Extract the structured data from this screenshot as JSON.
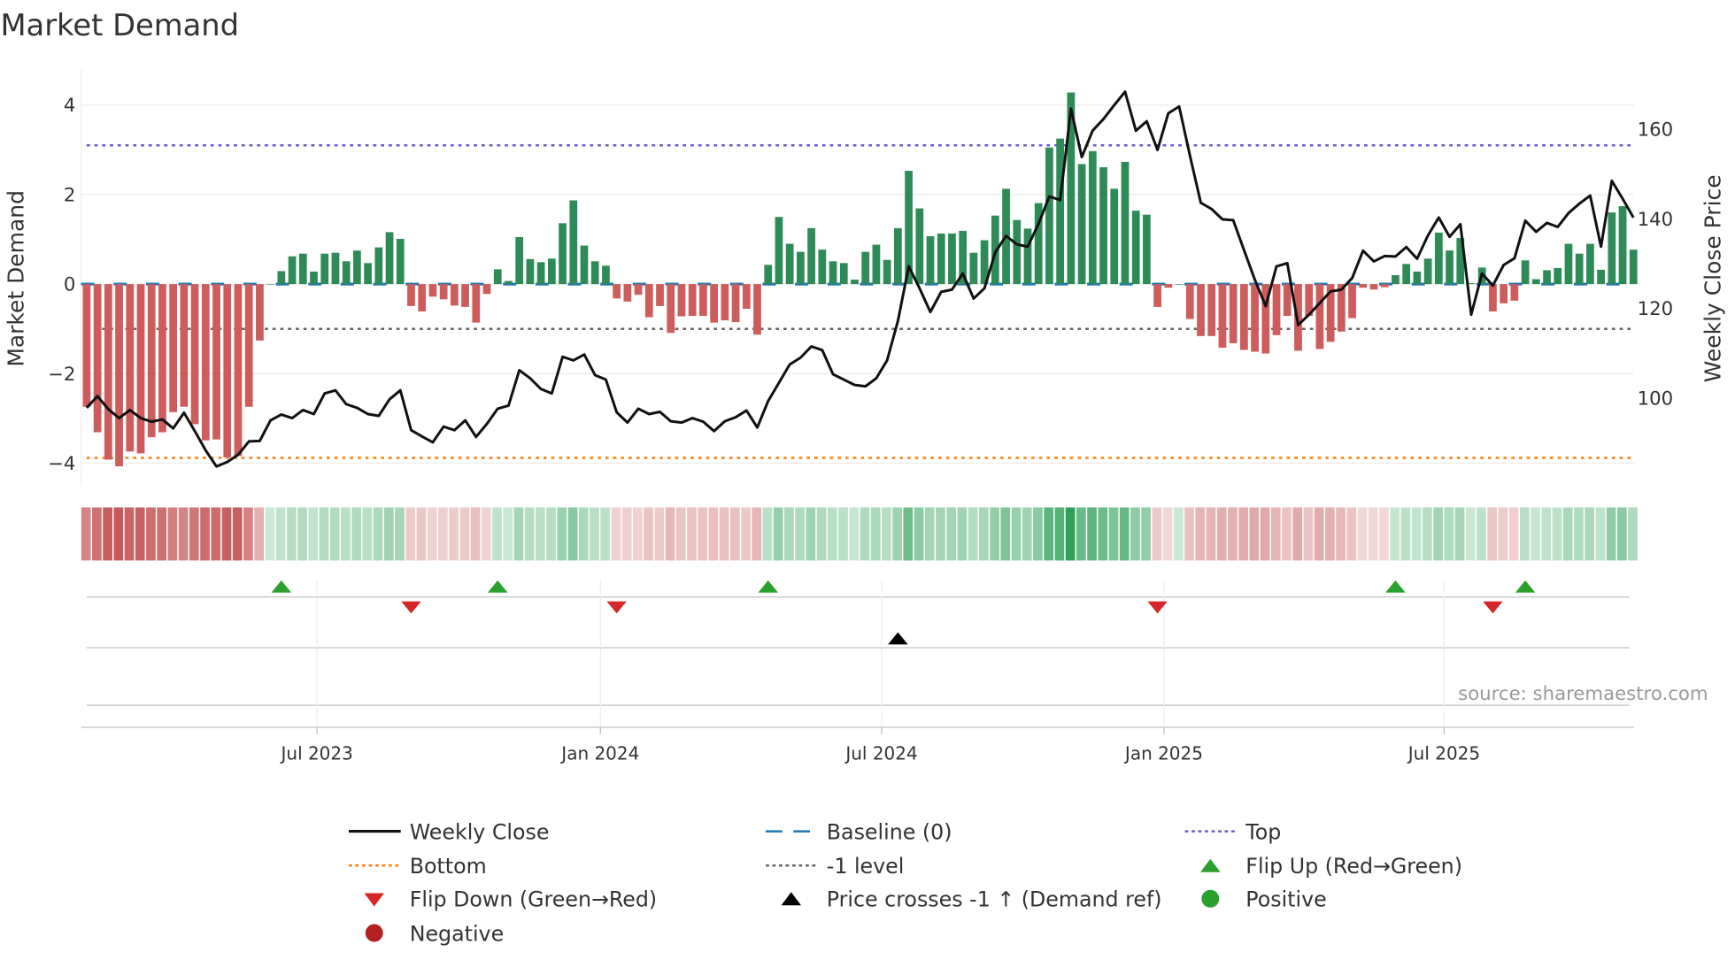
{
  "title": "Market Demand",
  "source": "source: sharemaestro.com",
  "colors": {
    "positive": "#2e8b57",
    "negative": "#cd5c5c",
    "baseline": "#1f77b4",
    "top": "#6a5acd",
    "bottom": "#ff7f0e",
    "minus_one": "#666666",
    "price": "#111111",
    "flip_up": "#2ca02c",
    "flip_down": "#d62728",
    "cross": "#000000"
  },
  "chart_data": {
    "type": "bar",
    "title": "Market Demand",
    "ylabel": "Market Demand",
    "y2label": "Weekly Close Price",
    "ylim": [
      -4.5,
      4.8
    ],
    "y2lim": [
      83,
      176
    ],
    "yticks": [
      4,
      2,
      0,
      -2,
      -4
    ],
    "ytick_labels": [
      "4",
      "2",
      "0",
      "−2",
      "−4"
    ],
    "y2ticks": [
      100,
      120,
      140,
      160
    ],
    "x_start": "2023-02-03",
    "x_step": "1 week",
    "xticks": [
      {
        "label": "Jul 2023",
        "week": 21.3
      },
      {
        "label": "Jan 2024",
        "week": 47.5
      },
      {
        "label": "Jul 2024",
        "week": 73.5
      },
      {
        "label": "Jan 2025",
        "week": 99.6
      },
      {
        "label": "Jul 2025",
        "week": 125.5
      }
    ],
    "levels": {
      "top": 3.1,
      "bottom": -3.88,
      "minus_one": -1,
      "baseline": 0
    },
    "demand": [
      -2.74,
      -3.31,
      -3.92,
      -4.07,
      -3.74,
      -3.78,
      -3.42,
      -3.31,
      -2.86,
      -2.74,
      -3.13,
      -3.49,
      -3.47,
      -3.87,
      -3.84,
      -2.74,
      -1.26,
      0.0,
      0.29,
      0.62,
      0.68,
      0.28,
      0.68,
      0.7,
      0.51,
      0.75,
      0.47,
      0.82,
      1.16,
      1.01,
      -0.49,
      -0.61,
      -0.28,
      -0.34,
      -0.48,
      -0.51,
      -0.86,
      -0.22,
      0.33,
      0.07,
      1.05,
      0.56,
      0.49,
      0.57,
      1.36,
      1.87,
      0.86,
      0.51,
      0.41,
      -0.32,
      -0.39,
      -0.24,
      -0.74,
      -0.49,
      -1.09,
      -0.72,
      -0.71,
      -0.71,
      -0.86,
      -0.81,
      -0.85,
      -0.55,
      -1.13,
      0.43,
      1.5,
      0.9,
      0.72,
      1.25,
      0.77,
      0.51,
      0.47,
      0.1,
      0.72,
      0.88,
      0.54,
      1.25,
      2.53,
      1.69,
      1.07,
      1.13,
      1.13,
      1.19,
      0.7,
      0.98,
      1.53,
      2.13,
      1.43,
      1.24,
      1.81,
      3.05,
      3.25,
      4.28,
      2.68,
      2.97,
      2.61,
      2.13,
      2.73,
      1.64,
      1.55,
      -0.51,
      -0.08,
      0.0,
      -0.78,
      -1.16,
      -1.16,
      -1.42,
      -1.32,
      -1.47,
      -1.51,
      -1.55,
      -1.14,
      -0.71,
      -1.49,
      -0.71,
      -1.45,
      -1.29,
      -1.06,
      -0.76,
      -0.08,
      -0.12,
      -0.07,
      0.2,
      0.45,
      0.28,
      0.57,
      1.15,
      0.75,
      1.03,
      0.02,
      0.37,
      -0.61,
      -0.43,
      -0.37,
      0.53,
      0.11,
      0.31,
      0.36,
      0.9,
      0.68,
      0.9,
      0.32,
      1.6,
      1.74,
      0.77
    ],
    "price": [
      97.8,
      100.4,
      97.5,
      95.5,
      97.3,
      95.5,
      94.7,
      95.2,
      93.2,
      96.7,
      92.6,
      88.3,
      84.7,
      85.7,
      87.3,
      90.3,
      90.4,
      95.0,
      96.3,
      95.5,
      97.3,
      96.4,
      101.0,
      101.7,
      98.6,
      97.8,
      96.4,
      96.0,
      99.7,
      101.7,
      92.8,
      91.4,
      90.1,
      93.6,
      92.8,
      95.0,
      91.3,
      94.2,
      97.6,
      98.3,
      106.2,
      104.4,
      102.0,
      101.0,
      109.2,
      108.4,
      109.7,
      105.1,
      104.1,
      96.8,
      94.5,
      97.6,
      96.4,
      96.9,
      94.8,
      94.5,
      95.5,
      94.7,
      92.6,
      94.8,
      95.7,
      97.2,
      93.4,
      99.3,
      103.4,
      107.5,
      109.0,
      111.5,
      110.7,
      105.3,
      104.1,
      102.9,
      102.6,
      104.4,
      108.4,
      117.2,
      129.4,
      124.5,
      119.2,
      123.7,
      124.2,
      127.8,
      122.2,
      124.5,
      132.5,
      136.2,
      134.3,
      133.8,
      138.9,
      145.0,
      144.2,
      164.6,
      153.8,
      159.7,
      162.3,
      165.4,
      168.4,
      159.7,
      161.8,
      155.4,
      163.6,
      165.1,
      154.1,
      143.6,
      142.2,
      139.9,
      139.7,
      133.0,
      126.4,
      120.5,
      129.4,
      130.1,
      116.3,
      118.6,
      121.2,
      123.8,
      124.2,
      126.8,
      132.9,
      130.5,
      131.7,
      131.6,
      133.7,
      131.1,
      136.3,
      140.3,
      136.0,
      138.8,
      118.6,
      127.8,
      125.1,
      129.7,
      131.2,
      139.6,
      137.1,
      139.1,
      138.2,
      141.3,
      143.4,
      145.2,
      133.8,
      148.5,
      144.5,
      140.3
    ],
    "events": {
      "flip_up_weeks": [
        18,
        38,
        63,
        121,
        133
      ],
      "flip_down_weeks": [
        30,
        49,
        99,
        130
      ],
      "price_cross_weeks": [
        75
      ]
    },
    "legend": [
      {
        "label": "Weekly Close",
        "kind": "line",
        "color": "#111111"
      },
      {
        "label": "Baseline (0)",
        "kind": "dash",
        "color": "#1f77b4"
      },
      {
        "label": "Top",
        "kind": "dot",
        "color": "#6a5acd"
      },
      {
        "label": "Bottom",
        "kind": "dot",
        "color": "#ff7f0e"
      },
      {
        "label": "-1 level",
        "kind": "dot",
        "color": "#666666"
      },
      {
        "label": "Flip Up (Red→Green)",
        "kind": "tri-up",
        "color": "#2ca02c"
      },
      {
        "label": "Flip Down (Green→Red)",
        "kind": "tri-down",
        "color": "#d62728"
      },
      {
        "label": "Price crosses -1 ↑ (Demand ref)",
        "kind": "tri-up",
        "color": "#000000"
      },
      {
        "label": "Positive",
        "kind": "circle",
        "color": "#2ca02c"
      },
      {
        "label": "Negative",
        "kind": "circle",
        "color": "#b22222"
      }
    ],
    "legend_placement": "bottom"
  }
}
